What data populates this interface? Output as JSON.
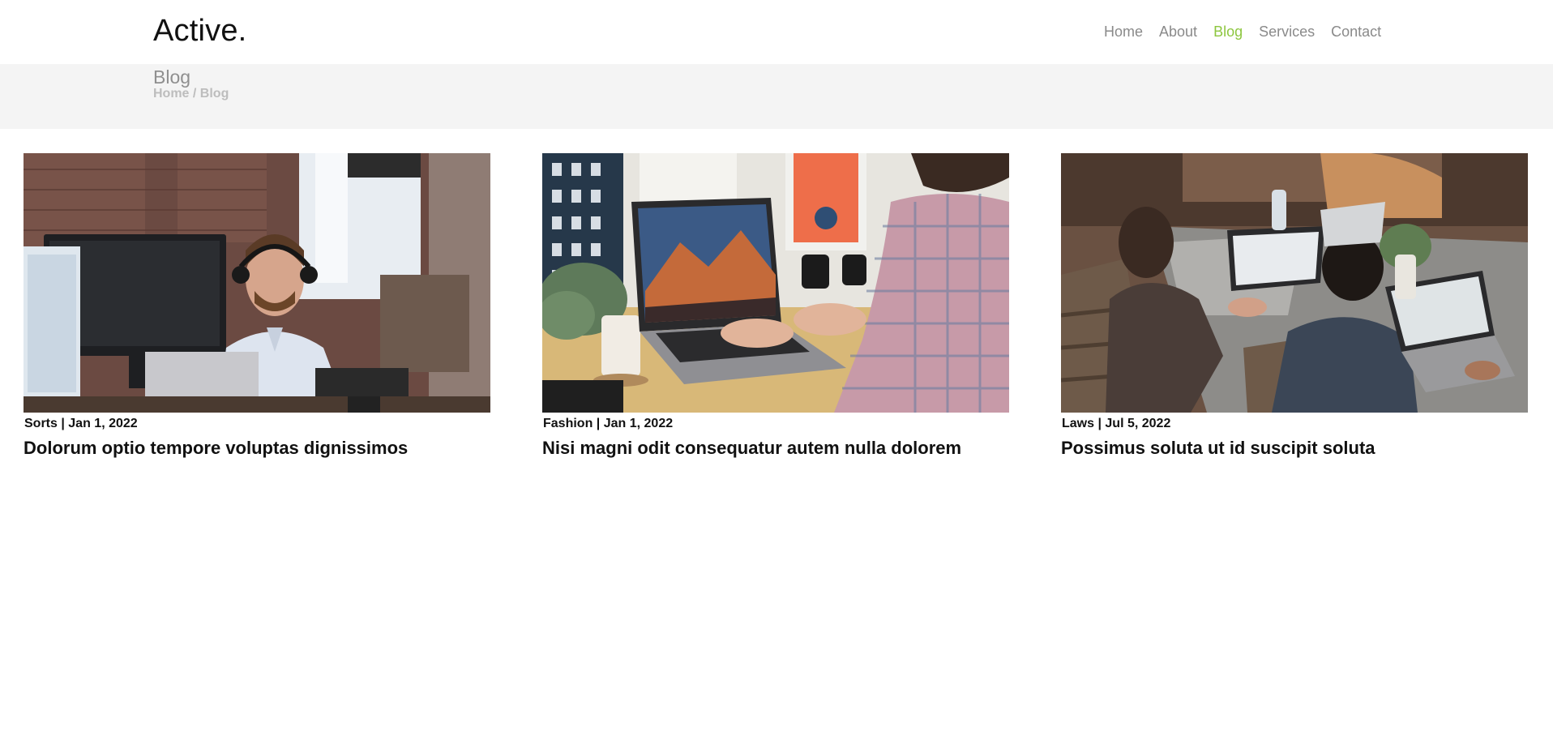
{
  "header": {
    "logo": "Active.",
    "nav": [
      {
        "label": "Home",
        "active": false
      },
      {
        "label": "About",
        "active": false
      },
      {
        "label": "Blog",
        "active": true
      },
      {
        "label": "Services",
        "active": false
      },
      {
        "label": "Contact",
        "active": false
      }
    ]
  },
  "page": {
    "title": "Blog",
    "breadcrumb": {
      "home": "Home",
      "separator": " / ",
      "current": "Blog"
    }
  },
  "posts": [
    {
      "category": "Sorts",
      "date": "Jan 1, 2022",
      "meta_separator": " | ",
      "title": "Dolorum optio tempore voluptas dignissimos",
      "image": "photo of man with headset working at desktop computer in office"
    },
    {
      "category": "Fashion",
      "date": "Jan 1, 2022",
      "meta_separator": " | ",
      "title": "Nisi magni odit consequatur autem nulla dolorem",
      "image": "photo of person typing on laptop at wooden desk with mug and camera lenses"
    },
    {
      "category": "Laws",
      "date": "Jul 5, 2022",
      "meta_separator": " | ",
      "title": "Possimus soluta ut id suscipit soluta",
      "image": "photo of people working on laptops at a shared table"
    }
  ],
  "colors": {
    "accent": "#8dc63f",
    "nav_text": "#8a8a8a",
    "band_bg": "#f4f4f4"
  }
}
